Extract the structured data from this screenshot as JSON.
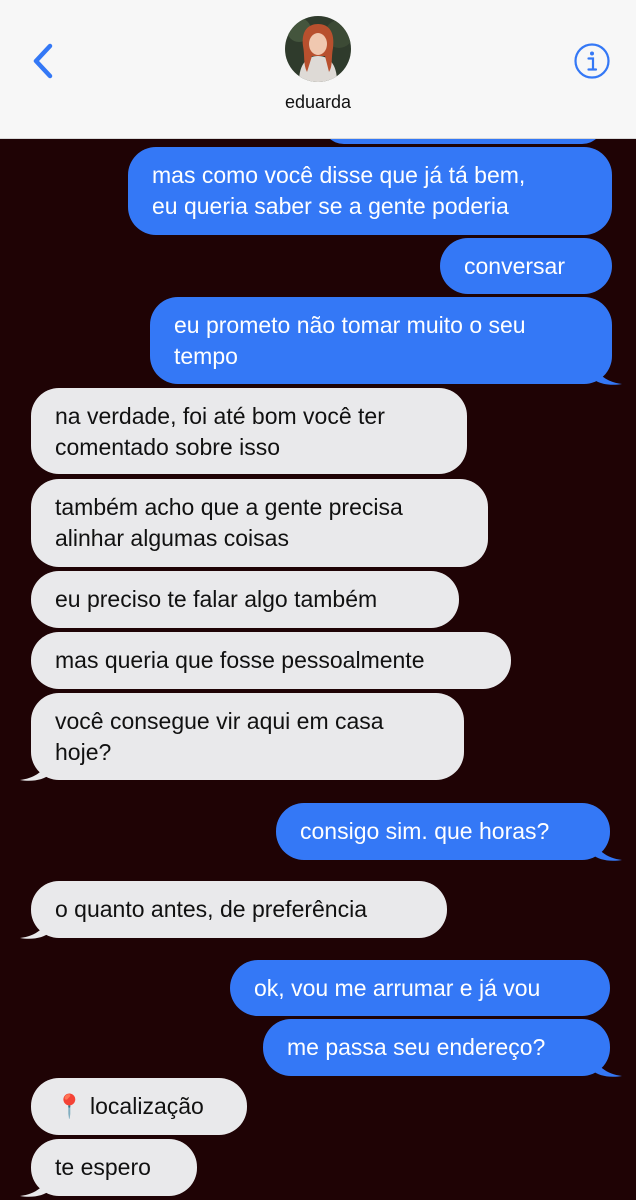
{
  "header": {
    "contact_name": "eduarda",
    "back_icon": "chevron-left-icon",
    "info_icon": "info-icon",
    "accent_color": "#3478f6"
  },
  "messages": [
    {
      "from": "me",
      "text": "mas como você disse que já tá bem,\neu queria saber se a gente poderia"
    },
    {
      "from": "me",
      "text": "conversar"
    },
    {
      "from": "me",
      "text": "eu prometo não tomar muito o seu\ntempo"
    },
    {
      "from": "them",
      "text": "na verdade, foi até bom você ter\ncomentado sobre isso"
    },
    {
      "from": "them",
      "text": "também acho que a gente precisa\nalinhar algumas coisas"
    },
    {
      "from": "them",
      "text": "eu preciso te falar algo também"
    },
    {
      "from": "them",
      "text": "mas queria que fosse pessoalmente"
    },
    {
      "from": "them",
      "text": "você consegue vir aqui em casa\nhoje?"
    },
    {
      "from": "me",
      "text": "consigo sim. que horas?"
    },
    {
      "from": "them",
      "text": "o quanto antes, de preferência"
    },
    {
      "from": "me",
      "text": "ok, vou me arrumar e já vou"
    },
    {
      "from": "me",
      "text": "me passa seu endereço?"
    },
    {
      "from": "them",
      "text": "📍 localização"
    },
    {
      "from": "them",
      "text": "te espero"
    }
  ],
  "colors": {
    "sent_bubble": "#3478f6",
    "received_bubble": "#e9e9eb",
    "background": "#1f0305"
  }
}
